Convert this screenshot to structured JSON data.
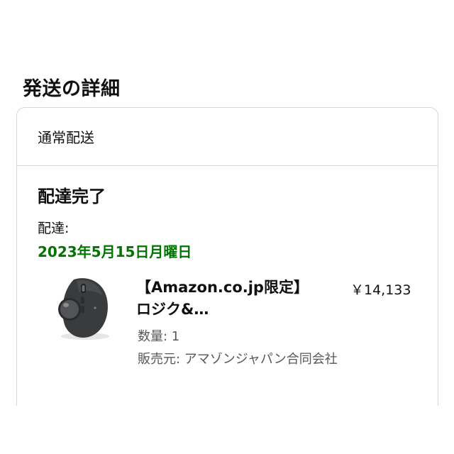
{
  "section": {
    "title": "発送の詳細"
  },
  "shipment": {
    "shipping_method": "通常配送",
    "status": "配達完了",
    "delivery_label": "配達:",
    "delivery_date": "2023年5月15日月曜日",
    "status_color": "#007600"
  },
  "item": {
    "title_line1": "【Amazon.co.jp限定】",
    "title_line2": "ロジク&…",
    "price": "￥14,133",
    "quantity": "数量: 1",
    "seller": "販売元: アマゾンジャパン合同会社",
    "image_icon": "trackball-mouse-image"
  }
}
